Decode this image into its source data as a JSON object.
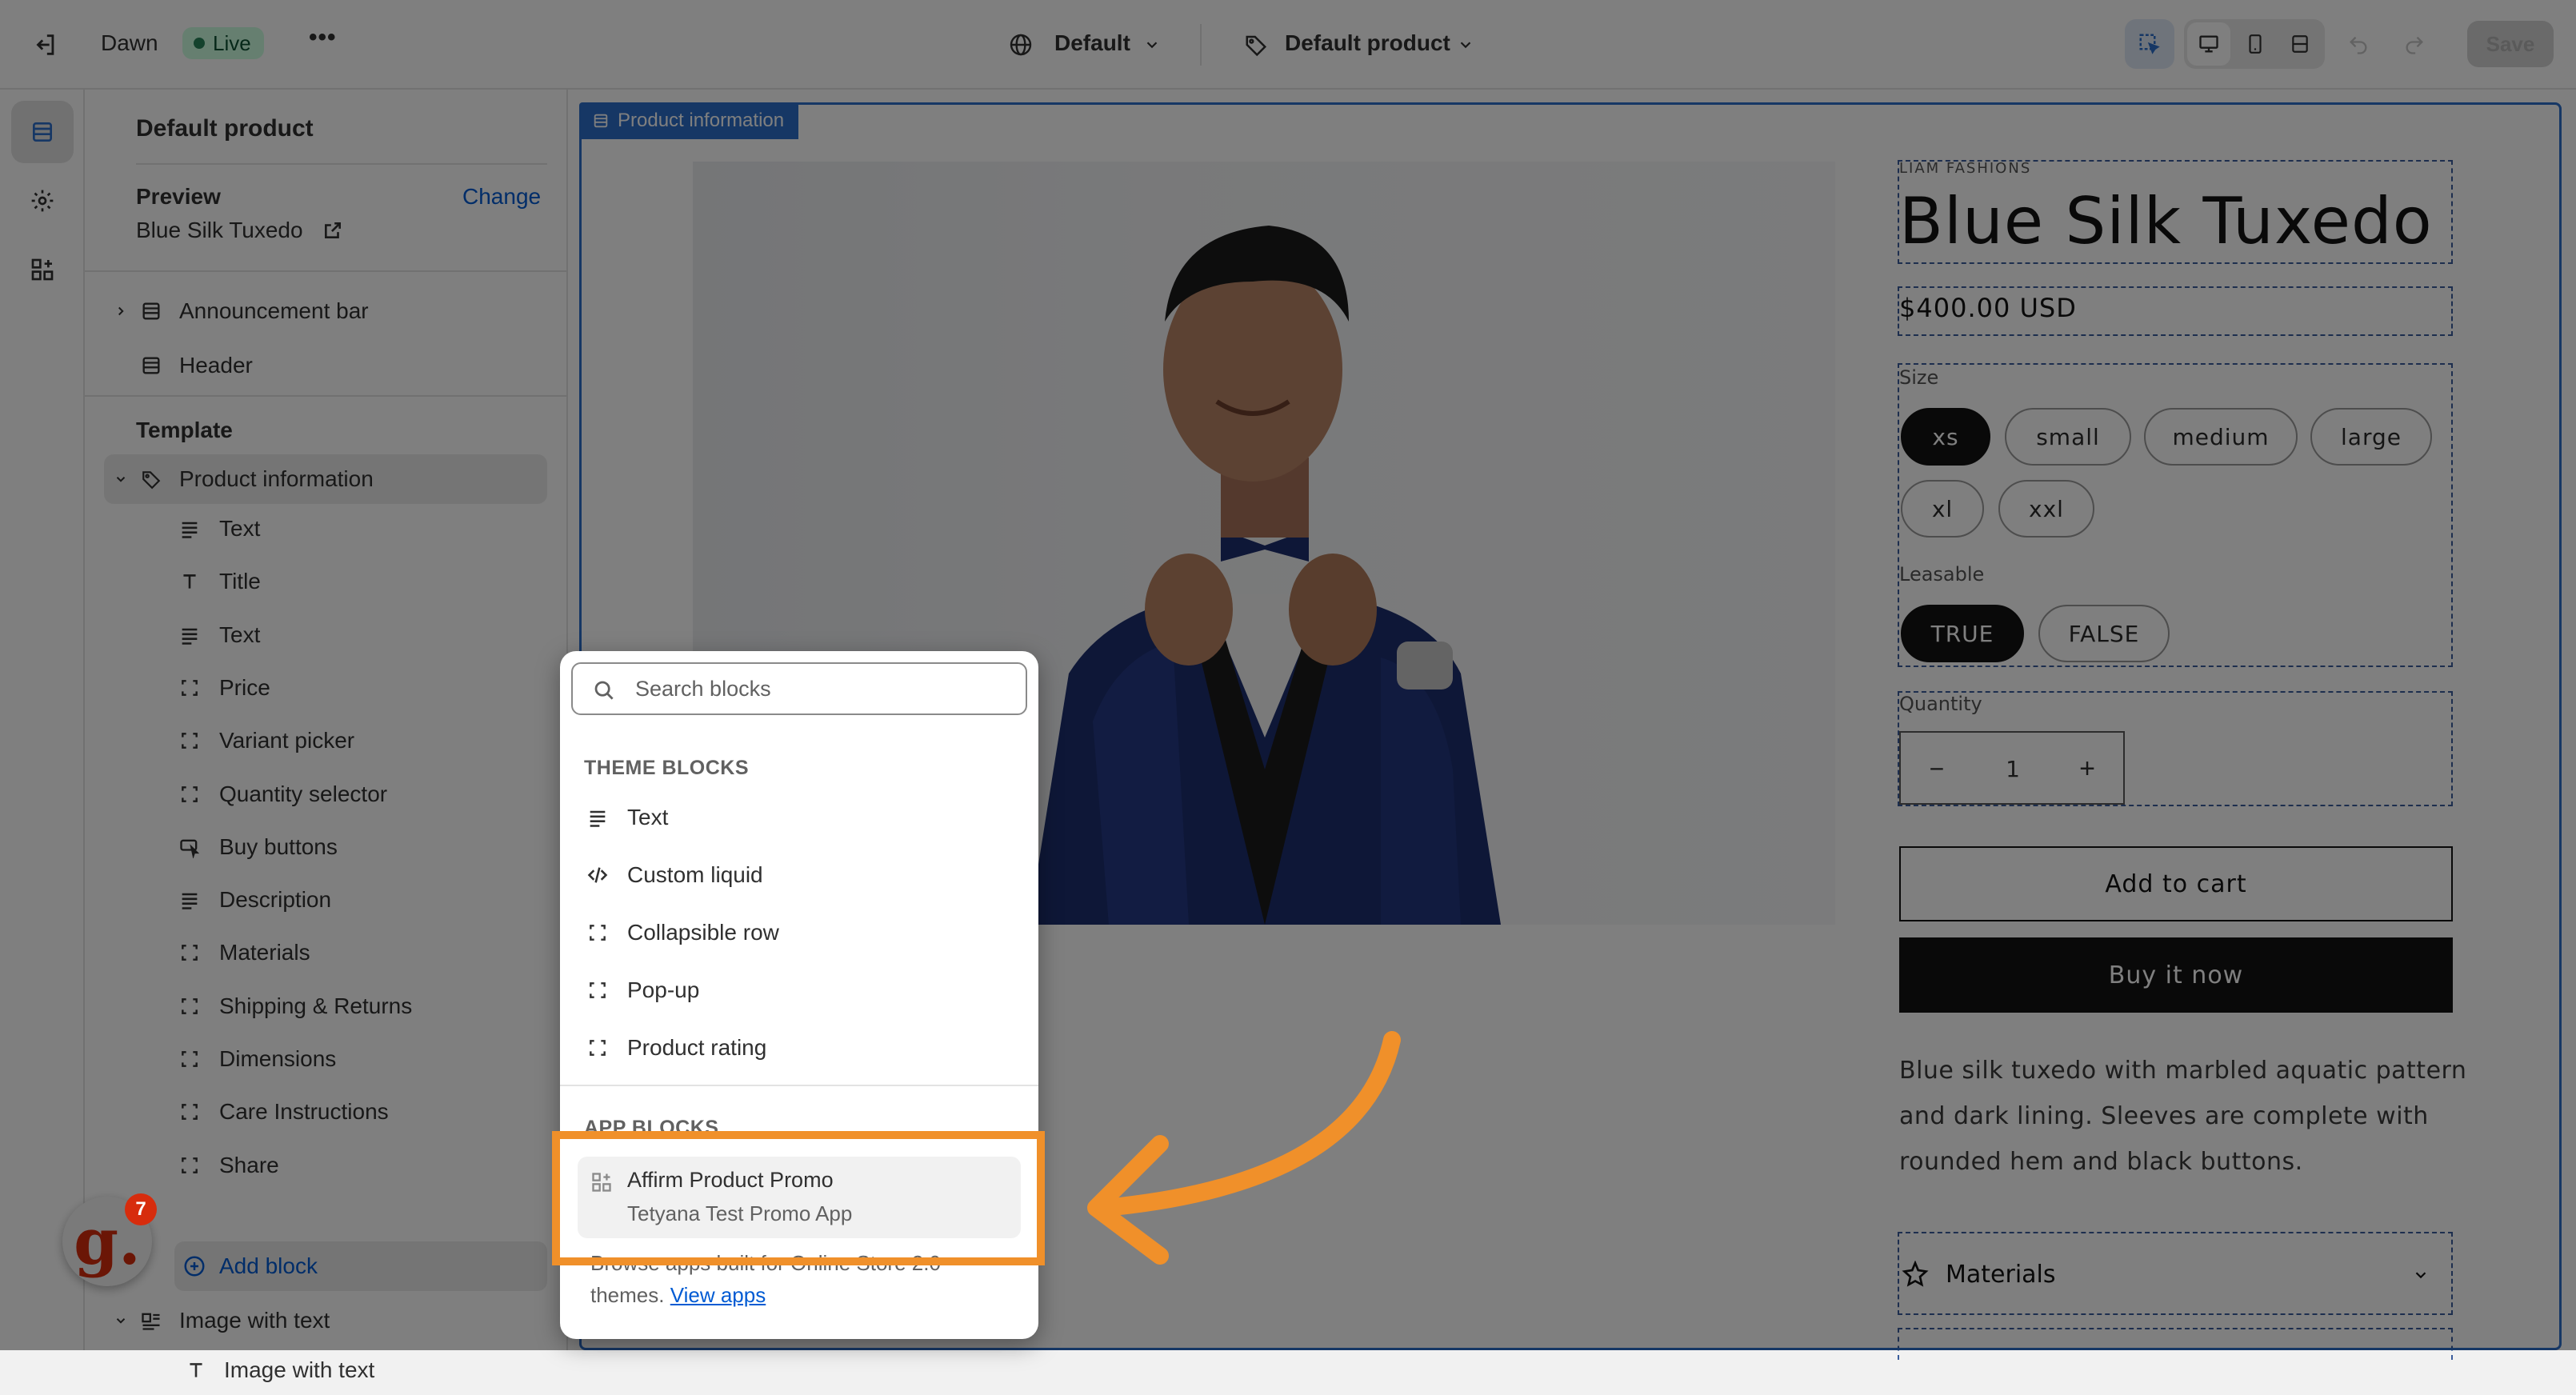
{
  "topbar": {
    "theme_name": "Dawn",
    "status": "Live",
    "more": "•••",
    "language": "Default",
    "template": "Default product",
    "save": "Save"
  },
  "sidebar": {
    "title": "Default product",
    "preview_label": "Preview",
    "change_link": "Change",
    "preview_product": "Blue Silk Tuxedo",
    "header_sections": [
      {
        "label": "Announcement bar",
        "icon": "section-icon"
      },
      {
        "label": "Header",
        "icon": "section-icon"
      }
    ],
    "template_title": "Template",
    "product_info": "Product information",
    "blocks": [
      {
        "label": "Text",
        "icon": "text-lines-icon"
      },
      {
        "label": "Title",
        "icon": "title-t-icon"
      },
      {
        "label": "Text",
        "icon": "text-lines-icon"
      },
      {
        "label": "Price",
        "icon": "block-icon"
      },
      {
        "label": "Variant picker",
        "icon": "block-icon"
      },
      {
        "label": "Quantity selector",
        "icon": "block-icon"
      },
      {
        "label": "Buy buttons",
        "icon": "buy-buttons-icon"
      },
      {
        "label": "Description",
        "icon": "text-lines-icon"
      },
      {
        "label": "Materials",
        "icon": "block-icon"
      },
      {
        "label": "Shipping & Returns",
        "icon": "block-icon"
      },
      {
        "label": "Dimensions",
        "icon": "block-icon"
      },
      {
        "label": "Care Instructions",
        "icon": "block-icon"
      },
      {
        "label": "Share",
        "icon": "block-icon"
      }
    ],
    "add_block": "Add block",
    "image_with_text": "Image with text",
    "image_with_text_child": "Image with text"
  },
  "preview": {
    "section_tag": "Product information",
    "vendor": "LIAM FASHIONS",
    "product_title": "Blue Silk Tuxedo",
    "price": "$400.00 USD",
    "size_label": "Size",
    "sizes": [
      "xs",
      "small",
      "medium",
      "large",
      "xl",
      "xxl"
    ],
    "selected_size": "xs",
    "leasable_label": "Leasable",
    "leasable_options": [
      "TRUE",
      "FALSE"
    ],
    "quantity_label": "Quantity",
    "quantity_value": "1",
    "quantity_minus": "−",
    "quantity_plus": "+",
    "add_to_cart": "Add to cart",
    "buy_now": "Buy it now",
    "description_lines": [
      "Blue silk tuxedo with marbled aquatic pattern",
      "and dark lining. Sleeves are complete with",
      "rounded hem and black buttons."
    ],
    "materials": "Materials"
  },
  "popover": {
    "search_placeholder": "Search blocks",
    "theme_blocks_title": "THEME BLOCKS",
    "theme_blocks": [
      {
        "label": "Text",
        "icon": "text-lines-icon"
      },
      {
        "label": "Custom liquid",
        "icon": "code-icon"
      },
      {
        "label": "Collapsible row",
        "icon": "block-icon"
      },
      {
        "label": "Pop-up",
        "icon": "block-icon"
      },
      {
        "label": "Product rating",
        "icon": "block-icon"
      }
    ],
    "app_blocks_title": "APP BLOCKS",
    "app_block_name": "Affirm Product Promo",
    "app_block_source": "Tetyana Test Promo App",
    "browse_text_1": "Browse apps built for Online Store 2.0",
    "browse_text_2": "themes.",
    "view_apps": "View apps"
  },
  "guidde_badge_count": "7",
  "colors": {
    "accent_blue": "#2c6ecb",
    "highlight_orange": "#f0902a",
    "live_green": "#29845a"
  }
}
